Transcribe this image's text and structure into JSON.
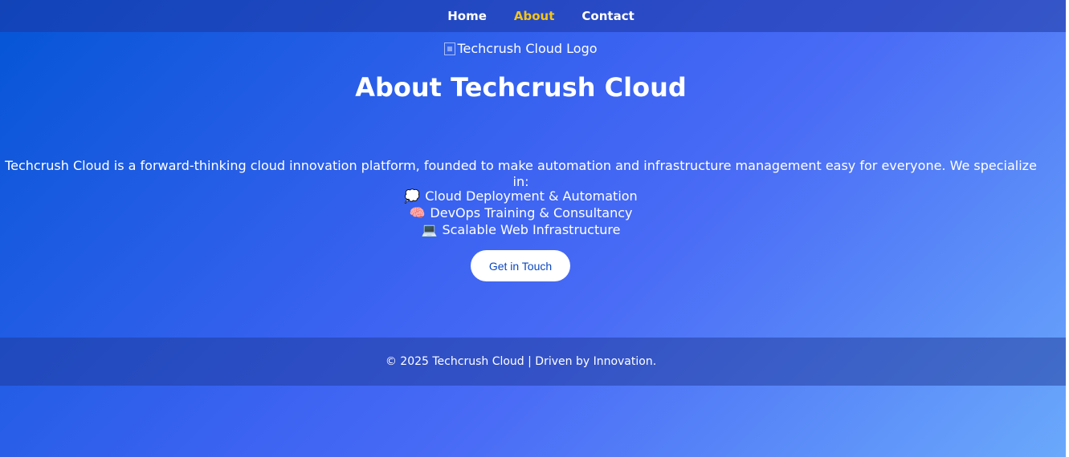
{
  "nav": {
    "items": [
      {
        "label": "Home",
        "active": false
      },
      {
        "label": "About",
        "active": true
      },
      {
        "label": "Contact",
        "active": false
      }
    ]
  },
  "logo": {
    "alt": "Techcrush Cloud Logo"
  },
  "page_title": "About Techcrush Cloud",
  "intro": "Techcrush Cloud is a forward-thinking cloud innovation platform, founded to make automation and infrastructure management easy for everyone. We specialize in:",
  "services": [
    {
      "emoji": "💭",
      "label": "Cloud Deployment & Automation"
    },
    {
      "emoji": "🧠",
      "label": "DevOps Training & Consultancy"
    },
    {
      "emoji": "💻",
      "label": "Scalable Web Infrastructure"
    }
  ],
  "cta": {
    "label": "Get in Touch"
  },
  "footer": {
    "text": "© 2025 Techcrush Cloud | Driven by Innovation."
  },
  "colors": {
    "accent_active_nav": "#f5c518",
    "cta_text": "#0b46c2",
    "gradient_start": "#0455d6",
    "gradient_end": "#6aa9fb"
  }
}
